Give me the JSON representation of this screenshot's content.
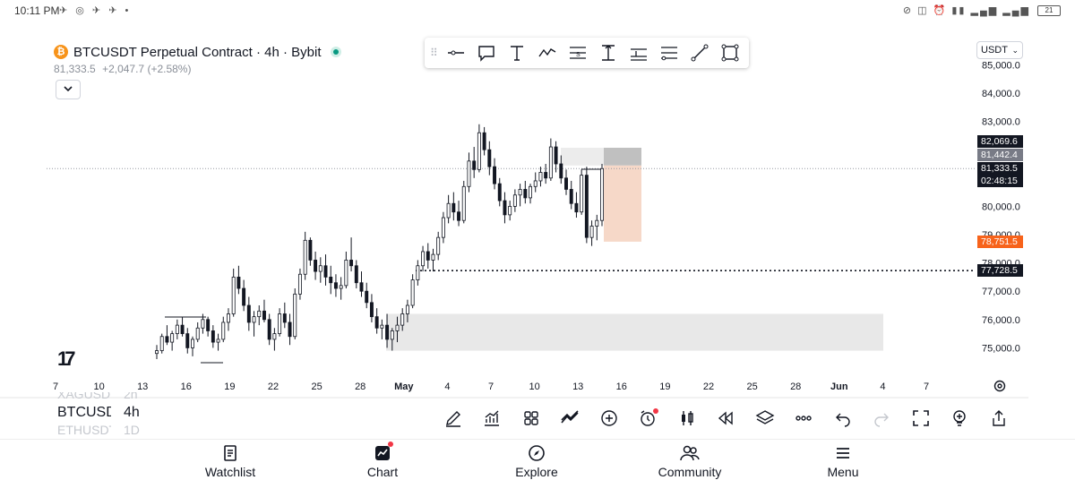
{
  "status_bar": {
    "time": "10:11 PM",
    "left_icons": "✈ ◎ ✈ ✈ •",
    "right_icons": "⊘ ◫ ⏰ ▮▮ ▂▄▆ ▂▄▆",
    "battery": "21"
  },
  "header": {
    "symbol_title": "BTCUSDT Perpetual Contract · 4h · Bybit",
    "last_price": "81,333.5",
    "change": "+2,047.7 (+2.58%)",
    "currency": "USDT"
  },
  "chart_data": {
    "type": "candlestick",
    "title": "BTCUSDT Perpetual Contract · 4h · Bybit",
    "y_axis": {
      "ticks": [
        85000,
        84000,
        83000,
        80000,
        79000,
        78000,
        77000,
        76000,
        75000
      ],
      "tick_labels": [
        "85,000.0",
        "84,000.0",
        "83,000.0",
        "80,000.0",
        "79,000.0",
        "78,000.0",
        "77,000.0",
        "76,000.0",
        "75,000.0"
      ],
      "range": [
        74200,
        85200
      ]
    },
    "x_axis": {
      "tick_labels": [
        "7",
        "10",
        "13",
        "16",
        "19",
        "22",
        "25",
        "28",
        "May",
        "4",
        "7",
        "10",
        "13",
        "16",
        "19",
        "22",
        "25",
        "28",
        "Jun",
        "4",
        "7"
      ],
      "bold_labels": [
        "May",
        "Jun"
      ]
    },
    "price_tags": [
      {
        "label": "82,069.6",
        "value": 82069.6,
        "color": "#131722"
      },
      {
        "label": "81,442.4",
        "value": 81442.4,
        "color": "#787b86"
      },
      {
        "label": "81,333.5",
        "value": 81333.5,
        "color": "#131722"
      },
      {
        "label": "02:48:15",
        "value": null,
        "color": "#131722"
      },
      {
        "label": "78,751.5",
        "value": 78751.5,
        "color": "#f7631b"
      },
      {
        "label": "77,728.5",
        "value": 77728.5,
        "color": "#131722"
      }
    ],
    "zones": [
      {
        "name": "demand-zone",
        "from_date": "Apr 28",
        "to_date": "May 26",
        "low": 74900,
        "high": 76200,
        "color": "#e8e8e8"
      },
      {
        "name": "short-position-risk",
        "from_date": "May 14",
        "to_date": "May 16",
        "low": 81442,
        "high": 82070,
        "color": "#c0c0c0"
      },
      {
        "name": "short-position-target",
        "from_date": "May 14",
        "to_date": "May 16",
        "low": 78751,
        "high": 81442,
        "color": "#f6d8c8"
      }
    ],
    "levels": [
      {
        "name": "last-price-line",
        "value": 81333.5,
        "style": "dotted"
      },
      {
        "name": "support-line",
        "value": 77728.5,
        "style": "dotted"
      }
    ],
    "series": [
      {
        "values": [
          [
            74800,
            75100,
            74600,
            74900
          ],
          [
            74900,
            75500,
            74800,
            75400
          ],
          [
            75400,
            75800,
            75100,
            75200
          ],
          [
            75200,
            75600,
            74900,
            75500
          ],
          [
            75500,
            76000,
            75300,
            75800
          ],
          [
            75800,
            76100,
            75400,
            75500
          ],
          [
            75500,
            75700,
            74800,
            75000
          ],
          [
            75000,
            75400,
            74700,
            75300
          ],
          [
            75300,
            75900,
            75200,
            75700
          ],
          [
            75700,
            76200,
            75500,
            76000
          ],
          [
            76000,
            76100,
            75400,
            75600
          ],
          [
            75600,
            75800,
            75000,
            75200
          ],
          [
            75200,
            75500,
            74900,
            75300
          ],
          [
            75300,
            76100,
            75200,
            75900
          ],
          [
            75900,
            76400,
            75600,
            76200
          ],
          [
            76200,
            77800,
            76100,
            77500
          ],
          [
            77500,
            77900,
            76900,
            77100
          ],
          [
            77100,
            77400,
            76300,
            76500
          ],
          [
            76500,
            76800,
            75600,
            75900
          ],
          [
            75900,
            76300,
            75400,
            76100
          ],
          [
            76100,
            76500,
            75800,
            76300
          ],
          [
            76300,
            76700,
            75900,
            76000
          ],
          [
            76000,
            76200,
            75100,
            75300
          ],
          [
            75300,
            75700,
            74900,
            75500
          ],
          [
            75500,
            76400,
            75400,
            76200
          ],
          [
            76200,
            76600,
            75700,
            75900
          ],
          [
            75900,
            76200,
            75100,
            75400
          ],
          [
            75400,
            77100,
            75300,
            76900
          ],
          [
            76900,
            77800,
            76700,
            77600
          ],
          [
            77600,
            79100,
            77400,
            78800
          ],
          [
            78800,
            78900,
            77900,
            78100
          ],
          [
            78100,
            78400,
            77400,
            77700
          ],
          [
            77700,
            78200,
            77300,
            77900
          ],
          [
            77900,
            78300,
            77200,
            77500
          ],
          [
            77500,
            77900,
            76900,
            77300
          ],
          [
            77300,
            77600,
            76800,
            77100
          ],
          [
            77100,
            77500,
            76700,
            77200
          ],
          [
            77200,
            78400,
            77100,
            78100
          ],
          [
            78100,
            78900,
            77700,
            77900
          ],
          [
            77900,
            78100,
            77100,
            77300
          ],
          [
            77300,
            77700,
            76800,
            77000
          ],
          [
            77000,
            77300,
            76400,
            76600
          ],
          [
            76600,
            76900,
            75900,
            76100
          ],
          [
            76100,
            76400,
            75500,
            75700
          ],
          [
            75700,
            76000,
            75300,
            75800
          ],
          [
            75800,
            76200,
            75000,
            75300
          ],
          [
            75300,
            75700,
            74900,
            75600
          ],
          [
            75600,
            76100,
            75200,
            75800
          ],
          [
            75800,
            76400,
            75600,
            76200
          ],
          [
            76200,
            76700,
            75900,
            76500
          ],
          [
            76500,
            77600,
            76400,
            77400
          ],
          [
            77400,
            78100,
            77200,
            77900
          ],
          [
            77900,
            78600,
            77700,
            78400
          ],
          [
            78400,
            78700,
            77800,
            78100
          ],
          [
            78100,
            78500,
            77700,
            78300
          ],
          [
            78300,
            79100,
            78100,
            78900
          ],
          [
            78900,
            79800,
            78700,
            79600
          ],
          [
            79600,
            80400,
            79400,
            80100
          ],
          [
            80100,
            80500,
            79500,
            79800
          ],
          [
            79800,
            80200,
            79300,
            79500
          ],
          [
            79500,
            80900,
            79400,
            80700
          ],
          [
            80700,
            81900,
            80500,
            81600
          ],
          [
            81600,
            82100,
            81000,
            81300
          ],
          [
            81300,
            82900,
            81200,
            82600
          ],
          [
            82600,
            82800,
            81800,
            82000
          ],
          [
            82000,
            82300,
            81100,
            81400
          ],
          [
            81400,
            81700,
            80600,
            80800
          ],
          [
            80800,
            81000,
            80000,
            80200
          ],
          [
            80200,
            80500,
            79400,
            79700
          ],
          [
            79700,
            80200,
            79500,
            80000
          ],
          [
            80000,
            80600,
            79800,
            80400
          ],
          [
            80400,
            80800,
            80000,
            80600
          ],
          [
            80600,
            80900,
            80100,
            80300
          ],
          [
            80300,
            80800,
            80100,
            80700
          ],
          [
            80700,
            81200,
            80500,
            80900
          ],
          [
            80900,
            81400,
            80700,
            81200
          ],
          [
            81200,
            81500,
            80800,
            81000
          ],
          [
            81000,
            82400,
            80900,
            82100
          ],
          [
            82100,
            82300,
            81200,
            81500
          ],
          [
            81500,
            81800,
            80800,
            81000
          ],
          [
            81000,
            81300,
            80400,
            80600
          ],
          [
            80600,
            80900,
            79900,
            80100
          ],
          [
            80100,
            80500,
            79600,
            79800
          ],
          [
            79800,
            81300,
            79700,
            81100
          ],
          [
            81100,
            81400,
            78700,
            78900
          ],
          [
            78900,
            79500,
            78600,
            79300
          ],
          [
            79300,
            79700,
            78800,
            79500
          ],
          [
            79500,
            81500,
            79300,
            81333.5
          ]
        ]
      }
    ],
    "grid": false,
    "log_scale": false
  },
  "draw_toolbar": {
    "tools": [
      "horizontal-line-icon",
      "callout-icon",
      "text-icon",
      "path-icon",
      "price-range-icon",
      "vertical-range-icon",
      "long-position-icon",
      "parallel-channel-icon",
      "trend-line-icon",
      "rectangle-icon"
    ]
  },
  "symbol_switcher": {
    "prev": {
      "symbol": "XAGUSD",
      "interval": "2h"
    },
    "current": {
      "symbol": "BTCUSDT",
      "interval": "4h"
    },
    "next": {
      "symbol": "ETHUSDT",
      "interval": "1D"
    }
  },
  "bottom_tools": [
    "drawing-pencil-icon",
    "indicators-icon",
    "layouts-icon",
    "compare-icon",
    "add-icon",
    "alert-clock-icon",
    "candle-style-icon",
    "replay-icon",
    "layers-icon",
    "more-icon",
    "undo-icon",
    "redo-icon",
    "fullscreen-icon",
    "idea-bulb-icon",
    "share-icon"
  ],
  "nav": {
    "watchlist": "Watchlist",
    "chart": "Chart",
    "explore": "Explore",
    "community": "Community",
    "menu": "Menu"
  },
  "tv_logo": "17"
}
